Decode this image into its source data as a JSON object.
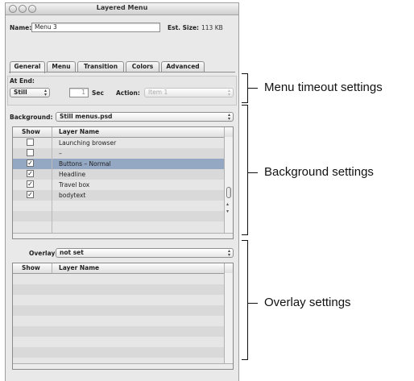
{
  "window": {
    "title": "Layered Menu"
  },
  "name_row": {
    "label": "Name:",
    "value": "Menu 3",
    "size_label": "Est. Size:",
    "size_value": "113 KB"
  },
  "tabs": [
    {
      "label": "General",
      "active": true
    },
    {
      "label": "Menu",
      "active": false
    },
    {
      "label": "Transition",
      "active": false
    },
    {
      "label": "Colors",
      "active": false
    },
    {
      "label": "Advanced",
      "active": false
    }
  ],
  "at_end": {
    "label": "At End:",
    "mode": "Still",
    "seconds": "1",
    "sec_label": "Sec",
    "action_label": "Action:",
    "action_value": "Item 1"
  },
  "background": {
    "label": "Background:",
    "value": "Still menus.psd",
    "columns": [
      "Show",
      "Layer Name"
    ],
    "rows": [
      {
        "show": false,
        "name": "Launching browser"
      },
      {
        "show": false,
        "name": "–"
      },
      {
        "show": true,
        "name": "Buttons – Normal",
        "selected": true
      },
      {
        "show": true,
        "name": "Headline"
      },
      {
        "show": true,
        "name": "Travel box"
      },
      {
        "show": true,
        "name": "bodytext"
      }
    ]
  },
  "overlay": {
    "label": "Overlay:",
    "value": "not set",
    "columns": [
      "Show",
      "Layer Name"
    ]
  },
  "callouts": {
    "menu_timeout": "Menu timeout settings",
    "background": "Background settings",
    "overlay": "Overlay settings"
  },
  "colors": {
    "selection": "#94a7c3",
    "window_bg": "#e9e9e9"
  }
}
